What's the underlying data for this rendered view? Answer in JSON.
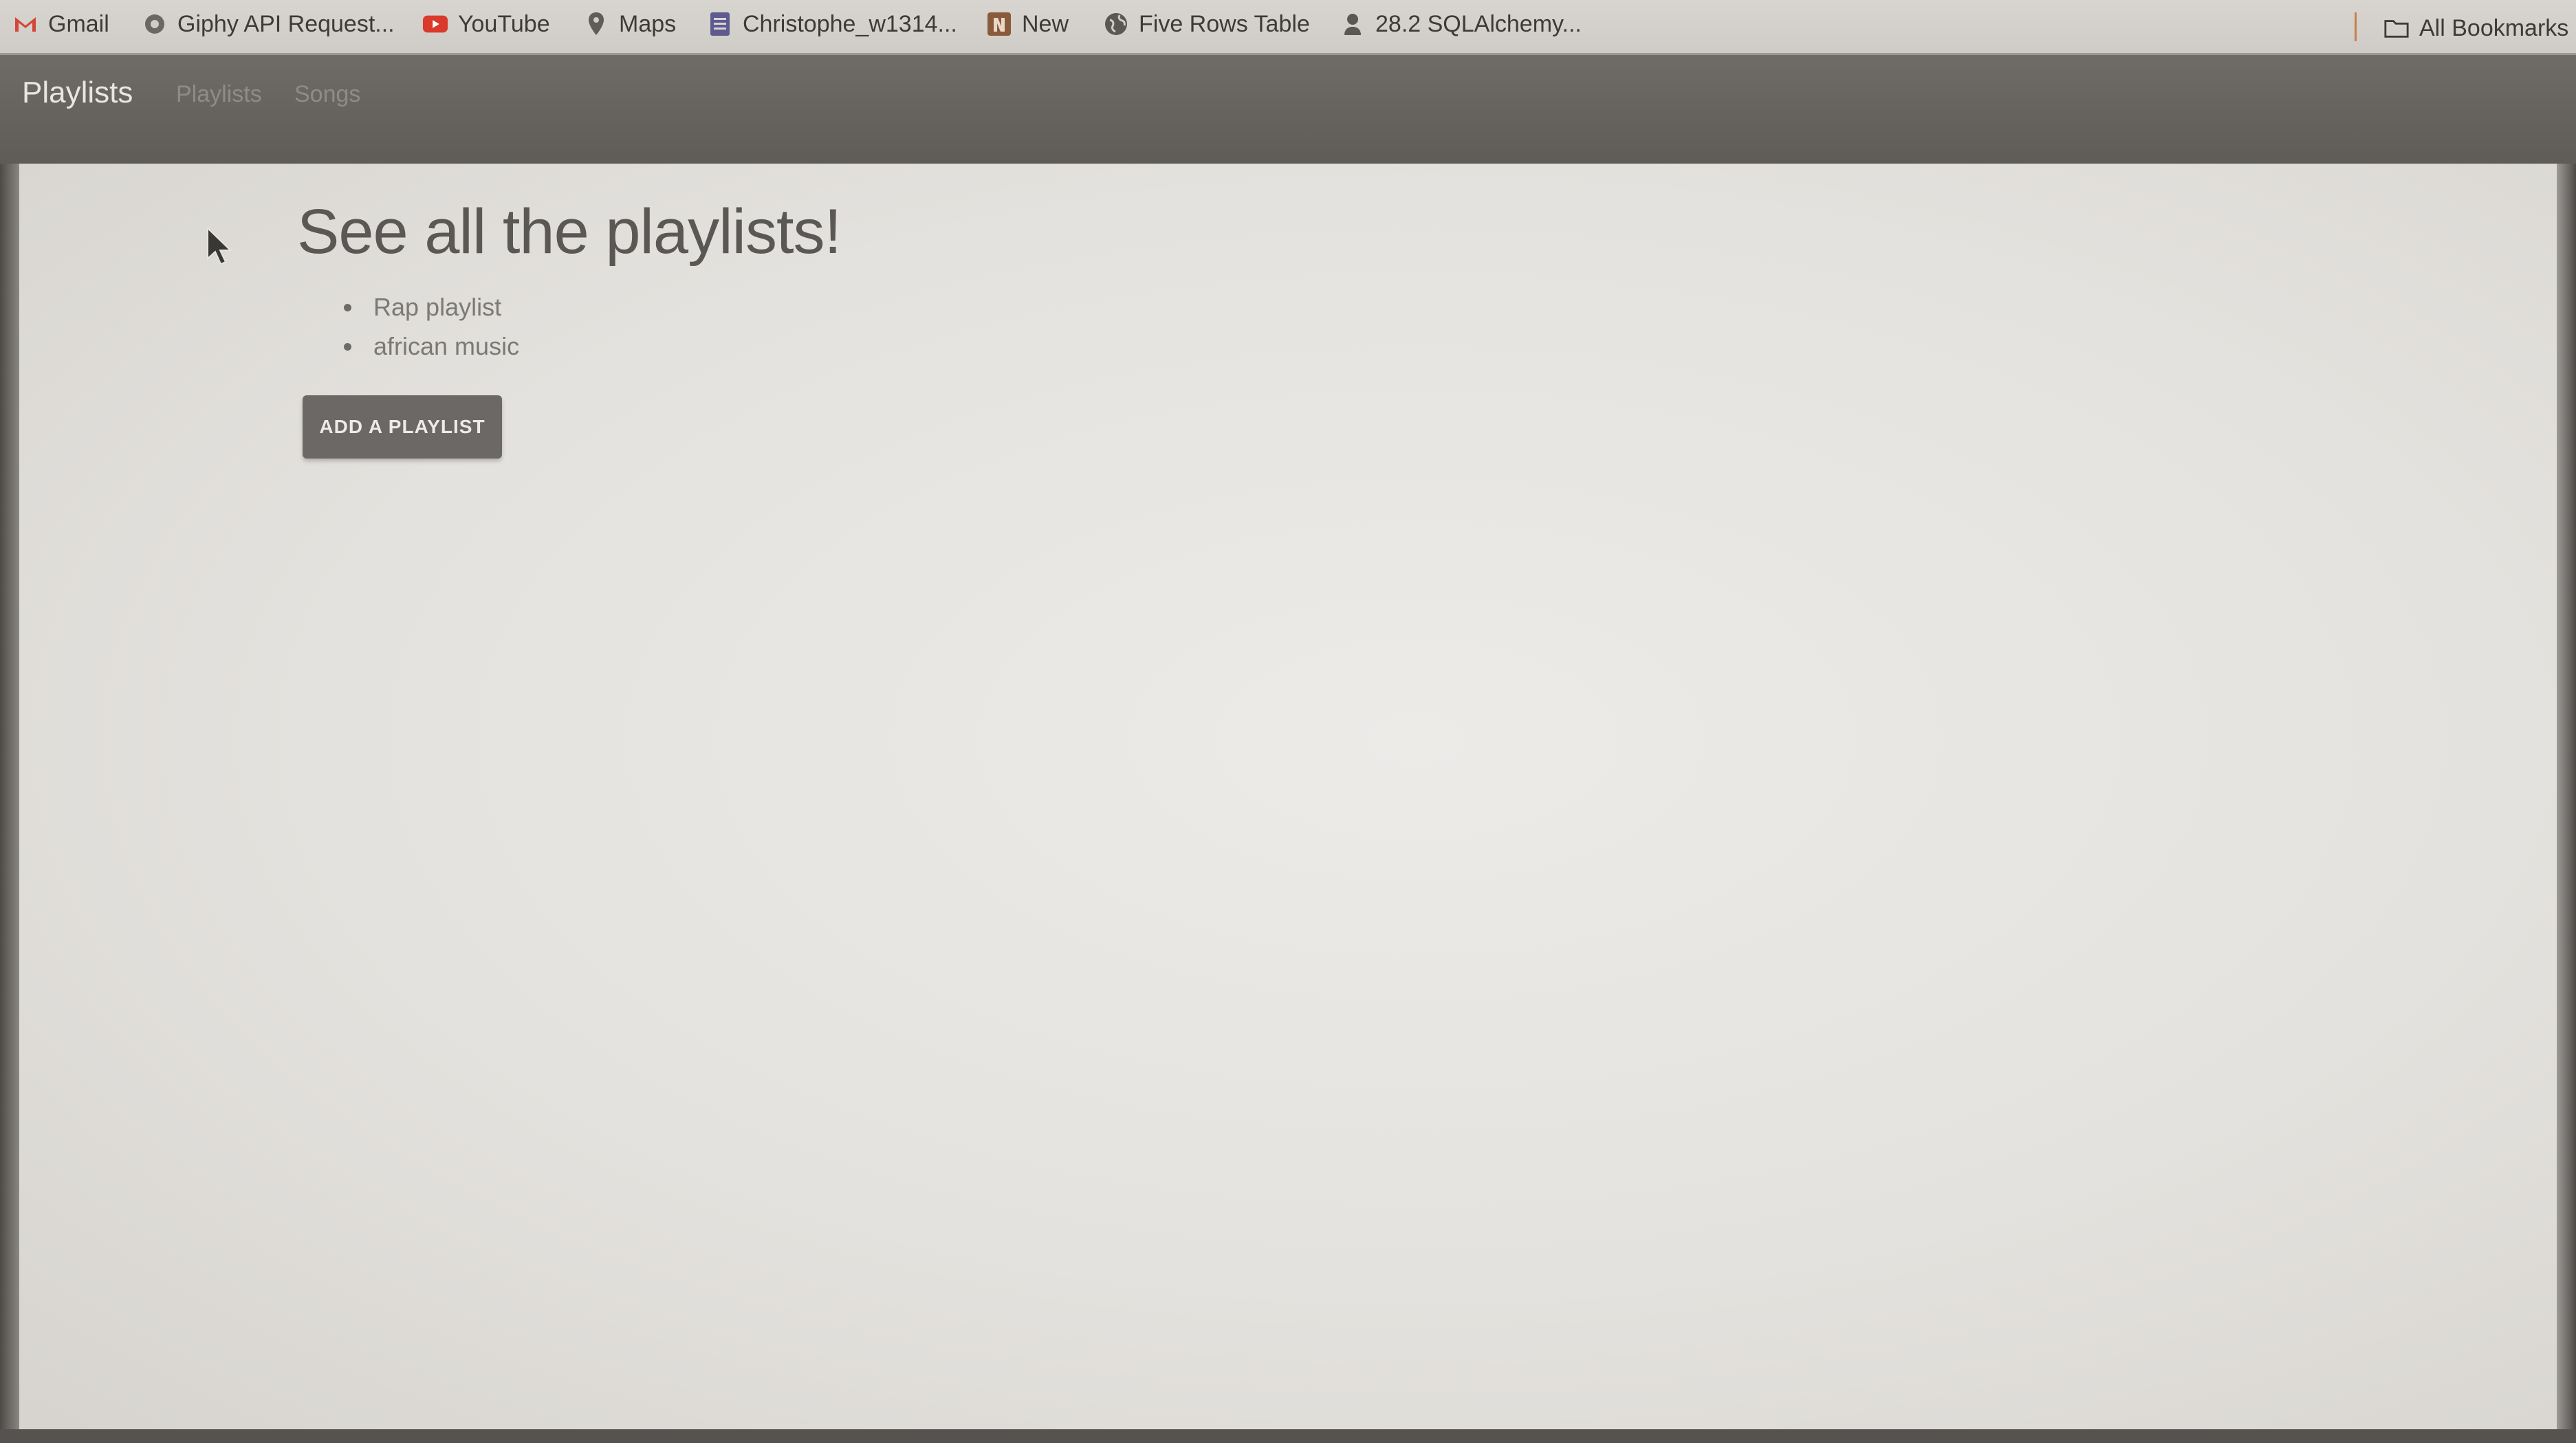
{
  "bookmarks": {
    "items": [
      {
        "label": "Gmail",
        "icon": "gmail-icon"
      },
      {
        "label": "Giphy API Request...",
        "icon": "globe-icon"
      },
      {
        "label": "YouTube",
        "icon": "youtube-icon"
      },
      {
        "label": "Maps",
        "icon": "map-pin-icon"
      },
      {
        "label": "Christophe_w1314...",
        "icon": "document-icon"
      },
      {
        "label": "New",
        "icon": "app-icon"
      },
      {
        "label": "Five Rows Table",
        "icon": "globe-icon"
      },
      {
        "label": "28.2 SQLAlchemy...",
        "icon": "person-icon"
      }
    ],
    "all_bookmarks": "All Bookmarks"
  },
  "navbar": {
    "brand": "Playlists",
    "links": [
      "Playlists",
      "Songs"
    ]
  },
  "main": {
    "title": "See all the playlists!",
    "playlists": [
      "Rap playlist",
      "african music"
    ],
    "add_button": "ADD A PLAYLIST"
  },
  "colors": {
    "navbar": "#65625e",
    "button": "#6b6865",
    "background": "#e6e4e0",
    "gmail_red": "#d44638",
    "youtube_red": "#d93a2b"
  }
}
